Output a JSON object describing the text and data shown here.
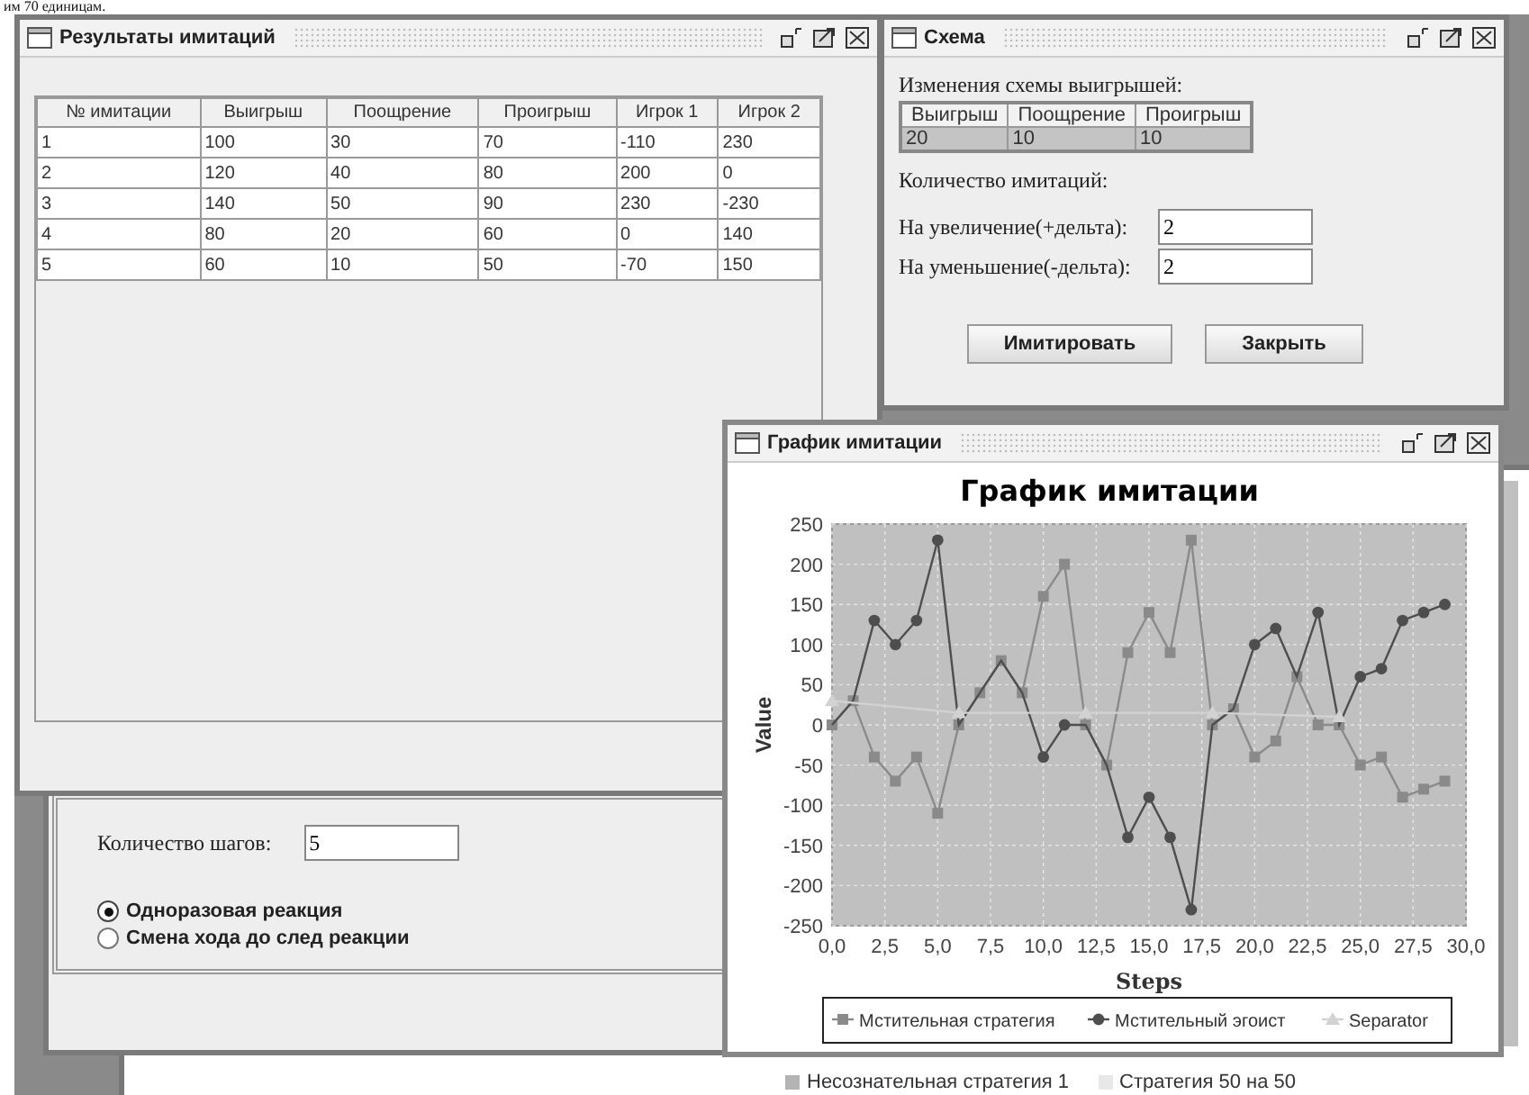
{
  "document_text": "им 70 единицам.",
  "results_window": {
    "title": "Результаты имитаций",
    "table": {
      "columns": [
        "№ имитации",
        "Выигрыш",
        "Поощрение",
        "Проигрыш",
        "Игрок 1",
        "Игрок 2"
      ],
      "rows": [
        [
          "1",
          "100",
          "30",
          "70",
          "-110",
          "230"
        ],
        [
          "2",
          "120",
          "40",
          "80",
          "200",
          "0"
        ],
        [
          "3",
          "140",
          "50",
          "90",
          "230",
          "-230"
        ],
        [
          "4",
          "80",
          "20",
          "60",
          "0",
          "140"
        ],
        [
          "5",
          "60",
          "10",
          "50",
          "-70",
          "150"
        ]
      ]
    }
  },
  "scheme_window": {
    "title": "Схема",
    "caption": "Изменения схемы выигрышей:",
    "table": {
      "columns": [
        "Выигрыш",
        "Поощрение",
        "Проигрыш"
      ],
      "rows": [
        [
          "20",
          "10",
          "10"
        ]
      ]
    },
    "count_label": "Количество имитаций:",
    "fields": [
      {
        "label": "На увеличение(+дельта):",
        "value": "2"
      },
      {
        "label": "На уменьшение(-дельта):",
        "value": "2"
      }
    ],
    "buttons": [
      "Имитировать",
      "Закрыть"
    ]
  },
  "steps_window": {
    "steps_label": "Количество шагов:",
    "steps_value": "5",
    "options": [
      {
        "label": "Одноразовая реакция",
        "selected": true
      },
      {
        "label": "Смена хода до след реакции",
        "selected": false
      }
    ]
  },
  "back_chart_window": {
    "legend": [
      {
        "label": "Несознательная стратегия 1",
        "color": "#b4b4b4"
      },
      {
        "label": "Стратегия 50 на 50",
        "color": "#e8e8e8"
      }
    ]
  },
  "chart_window": {
    "title": "График имитации",
    "chart_data": {
      "type": "line",
      "title": "График имитации",
      "xlabel": "Steps",
      "ylabel": "Value",
      "x": [
        0,
        1,
        2,
        3,
        4,
        5,
        6,
        7,
        8,
        9,
        10,
        11,
        12,
        13,
        14,
        15,
        16,
        17,
        18,
        19,
        20,
        21,
        22,
        23,
        24,
        25,
        26,
        27,
        28,
        29
      ],
      "series": [
        {
          "name": "Мстительная стратегия",
          "color": "#8a8a8a",
          "marker": "square",
          "values": [
            0,
            30,
            -40,
            -70,
            -40,
            -110,
            0,
            40,
            80,
            40,
            160,
            200,
            0,
            -50,
            90,
            140,
            90,
            230,
            0,
            20,
            -40,
            -20,
            60,
            0,
            0,
            -50,
            -40,
            -90,
            -80,
            -70
          ]
        },
        {
          "name": "Мстительный эгоист",
          "color": "#4e4e4e",
          "marker": "circle",
          "values": [
            0,
            30,
            130,
            100,
            130,
            230,
            0,
            40,
            80,
            40,
            -40,
            0,
            0,
            -50,
            -140,
            -90,
            -140,
            -230,
            0,
            20,
            100,
            120,
            60,
            140,
            0,
            60,
            70,
            130,
            140,
            150
          ]
        },
        {
          "name": "Separator",
          "color": "#d2d2d2",
          "marker": "triangle",
          "values": [
            30,
            null,
            null,
            null,
            null,
            null,
            15,
            null,
            null,
            null,
            null,
            null,
            15,
            null,
            null,
            null,
            null,
            null,
            15,
            null,
            null,
            null,
            null,
            null,
            10,
            null,
            null,
            null,
            null,
            null
          ]
        }
      ],
      "grid": true,
      "legend": true,
      "xlim": [
        0,
        30
      ],
      "ylim": [
        -250,
        250
      ],
      "xticks": [
        {
          "value": 0,
          "label": "0,0"
        },
        {
          "value": 2.5,
          "label": "2,5"
        },
        {
          "value": 5,
          "label": "5,0"
        },
        {
          "value": 7.5,
          "label": "7,5"
        },
        {
          "value": 10,
          "label": "10,0"
        },
        {
          "value": 12.5,
          "label": "12,5"
        },
        {
          "value": 15,
          "label": "15,0"
        },
        {
          "value": 17.5,
          "label": "17,5"
        },
        {
          "value": 20,
          "label": "20,0"
        },
        {
          "value": 22.5,
          "label": "22,5"
        },
        {
          "value": 25,
          "label": "25,0"
        },
        {
          "value": 27.5,
          "label": "27,5"
        },
        {
          "value": 30,
          "label": "30,0"
        }
      ],
      "yticks": [
        -250,
        -200,
        -150,
        -100,
        -50,
        0,
        50,
        100,
        150,
        200,
        250
      ]
    }
  }
}
